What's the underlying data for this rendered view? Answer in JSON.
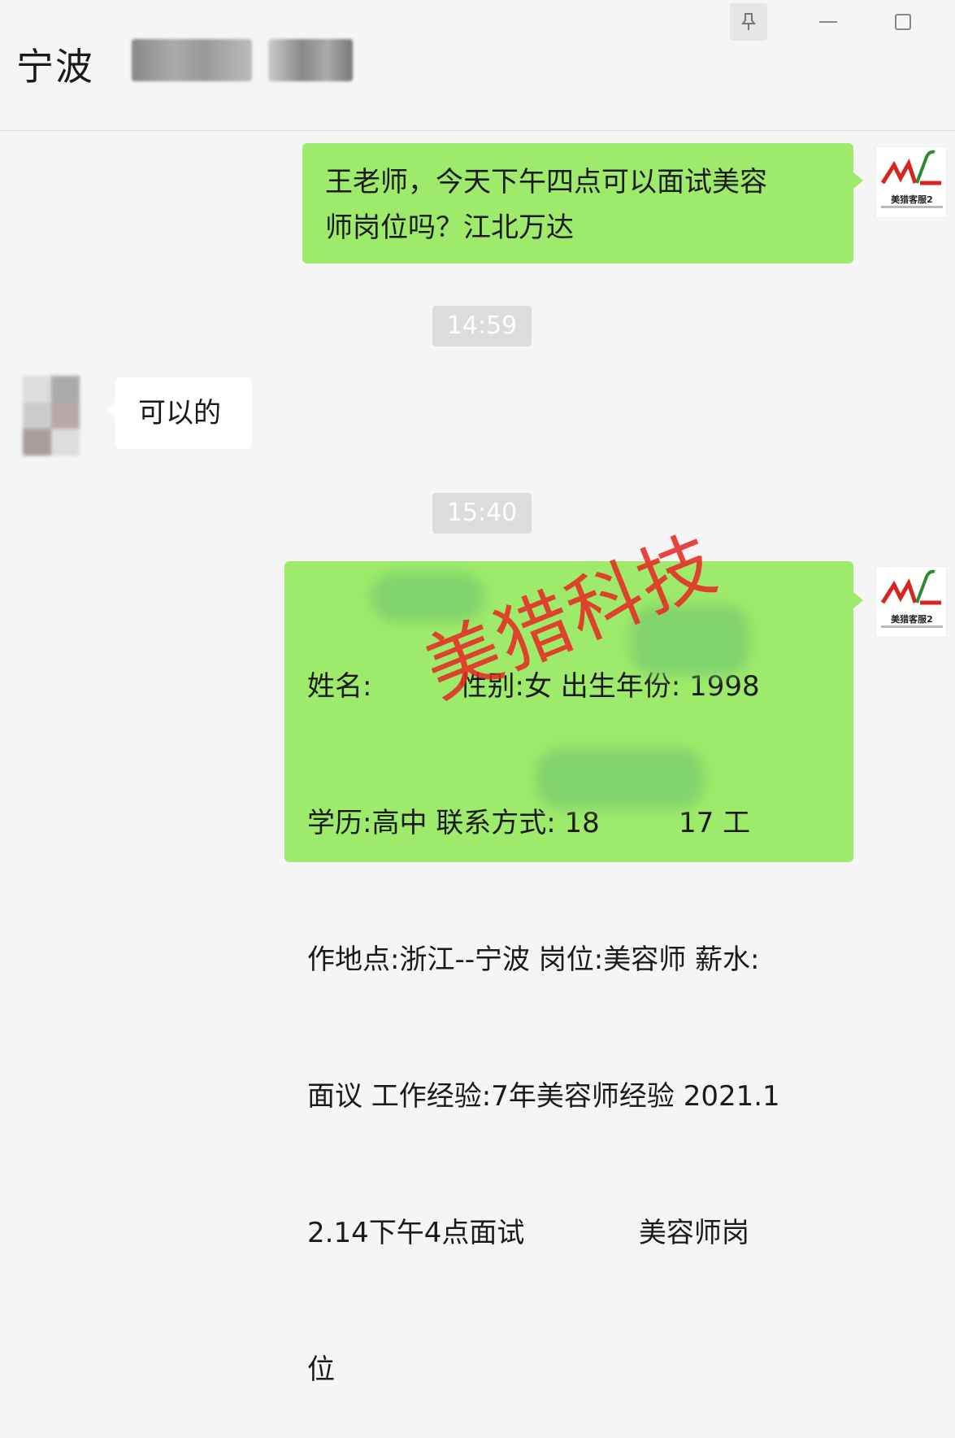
{
  "header": {
    "title": "宁波"
  },
  "window_controls": {
    "pin_icon": "pin-icon",
    "minimize_icon": "minimize-icon",
    "maximize_icon": "maximize-icon"
  },
  "messages": [
    {
      "side": "right",
      "text_line1": "王老师，今天下午四点可以面试美容",
      "text_line2": "师岗位吗？江北万达"
    },
    {
      "type": "timestamp",
      "text": "14:59"
    },
    {
      "side": "left",
      "text": "可以的"
    },
    {
      "type": "timestamp",
      "text": "15:40"
    },
    {
      "side": "right",
      "lines": [
        "姓名:          性别:女 出生年份: 1998",
        "学历:高中 联系方式: 18         17 工",
        "作地点:浙江--宁波 岗位:美容师 薪水:",
        "面议 工作经验:7年美容师经验 2021.1",
        "2.14下午4点面试             美容师岗",
        "位"
      ]
    }
  ],
  "avatar_logo": {
    "label": "美猎客服2"
  },
  "watermark": "美猎科技",
  "colors": {
    "bubble_green": "#9eea6a",
    "background": "#f5f5f5",
    "watermark_red": "#e8251f"
  }
}
